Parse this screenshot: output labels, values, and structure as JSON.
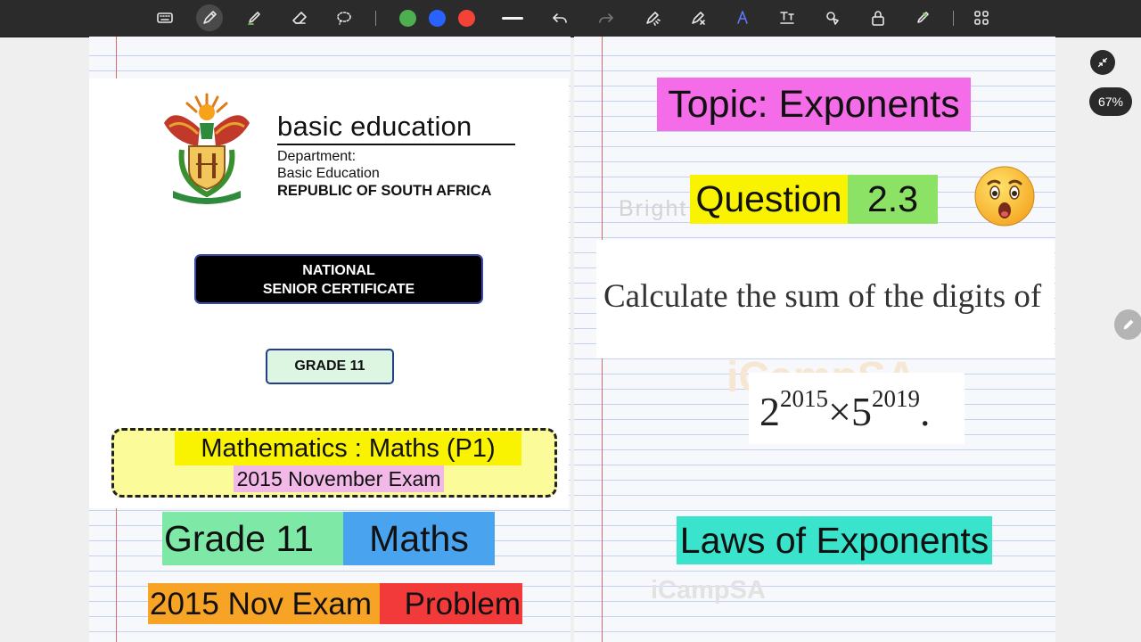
{
  "toolbar": {
    "tools": [
      "keyboard-icon",
      "pen-icon",
      "highlighter-icon",
      "eraser-icon",
      "lasso-icon",
      "undo-icon",
      "redo-icon",
      "laser-pointer-icon",
      "shape-pen-icon",
      "handwriting-icon",
      "text-box-icon",
      "shapes-icon",
      "lock-icon",
      "marker-icon",
      "apps-grid-icon"
    ],
    "active_tool": "pen-icon",
    "colors": [
      "#4caf50",
      "#2962ff",
      "#f44336"
    ]
  },
  "cover": {
    "brand_title": "basic education",
    "department_line1": "Department:",
    "department_line2": "Basic Education",
    "republic": "REPUBLIC OF SOUTH AFRICA",
    "nsc_line1": "NATIONAL",
    "nsc_line2": "SENIOR CERTIFICATE",
    "grade": "GRADE 11",
    "subject": "Mathematics : Maths (P1)",
    "exam": "2015 November Exam"
  },
  "labels": {
    "grade": "Grade 11",
    "maths": "Maths",
    "year_exam": "2015 Nov Exam",
    "problem": "Problem"
  },
  "right": {
    "topic": "Topic: Exponents",
    "question_label": "Question",
    "question_number": "2.3",
    "question_text": "Calculate the sum of the digits of",
    "expr_base1": "2",
    "expr_exp1": "2015",
    "expr_times": "×",
    "expr_base2": "5",
    "expr_exp2": "2019",
    "expr_end": ".",
    "laws": "Laws of Exponents",
    "watermark_bright": "Bright",
    "watermark_icamp": "iCampSA"
  },
  "ui": {
    "zoom": "67%"
  }
}
